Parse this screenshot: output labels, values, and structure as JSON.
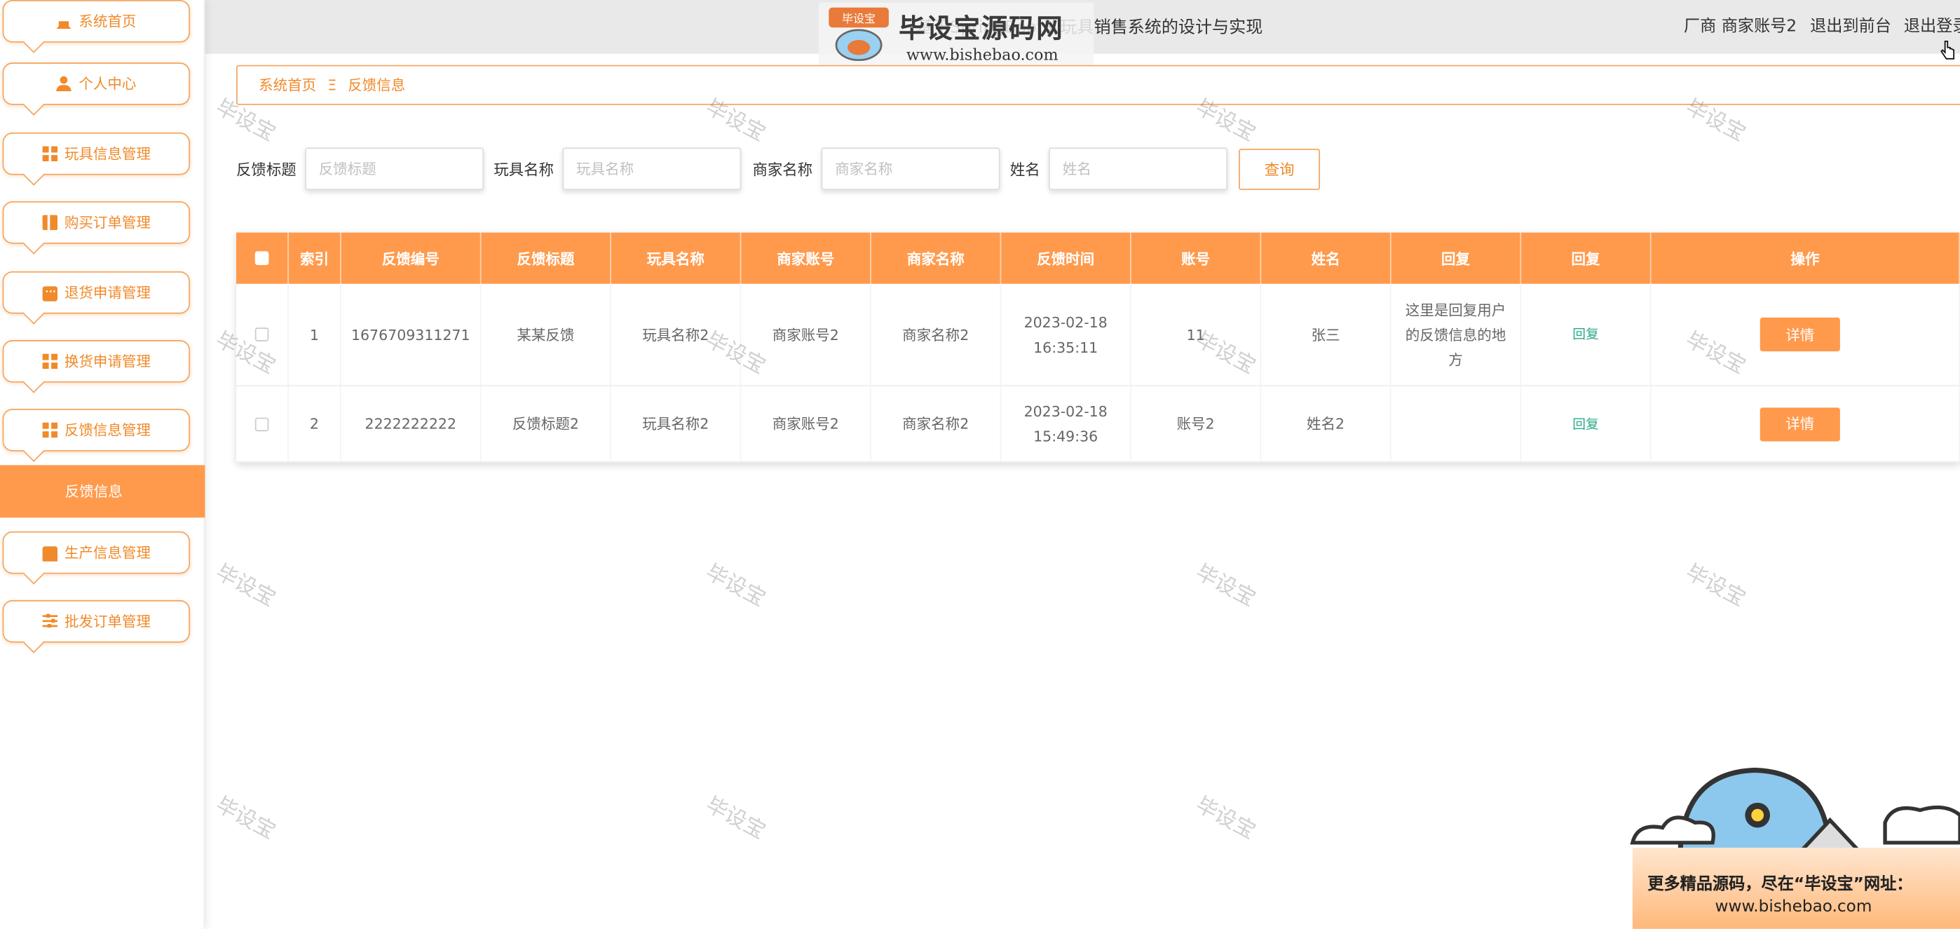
{
  "header": {
    "title": "基于SpringBoot的玩具销售系统的设计与实现",
    "user": "厂商 商家账号2",
    "to_front": "退出到前台",
    "logout": "退出登录"
  },
  "logo": {
    "badge": "毕设宝",
    "name": "毕设宝源码网",
    "url": "www.bishebao.com"
  },
  "sidebar": {
    "items": [
      {
        "label": "系统首页",
        "icon": "home-icon"
      },
      {
        "label": "个人中心",
        "icon": "user-icon"
      },
      {
        "label": "玩具信息管理",
        "icon": "grid-icon"
      },
      {
        "label": "购买订单管理",
        "icon": "box-icon"
      },
      {
        "label": "退货申请管理",
        "icon": "chat-icon"
      },
      {
        "label": "换货申请管理",
        "icon": "grid-icon"
      },
      {
        "label": "反馈信息管理",
        "icon": "grid-icon"
      },
      {
        "label": "生产信息管理",
        "icon": "print-icon"
      },
      {
        "label": "批发订单管理",
        "icon": "sliders-icon"
      }
    ],
    "active_sub": "反馈信息"
  },
  "breadcrumb": {
    "home": "系统首页",
    "separator": "Ξ",
    "current": "反馈信息"
  },
  "search": {
    "fields": [
      {
        "label": "反馈标题",
        "placeholder": "反馈标题"
      },
      {
        "label": "玩具名称",
        "placeholder": "玩具名称"
      },
      {
        "label": "商家名称",
        "placeholder": "商家名称"
      },
      {
        "label": "姓名",
        "placeholder": "姓名"
      }
    ],
    "button": "查询"
  },
  "table": {
    "headers": [
      "索引",
      "反馈编号",
      "反馈标题",
      "玩具名称",
      "商家账号",
      "商家名称",
      "反馈时间",
      "账号",
      "姓名",
      "回复",
      "回复",
      "操作"
    ],
    "rows": [
      {
        "index": "1",
        "code": "1676709311271",
        "title": "某某反馈",
        "toy": "玩具名称2",
        "merchant_account": "商家账号2",
        "merchant_name": "商家名称2",
        "time": "2023-02-18 16:35:11",
        "account": "11",
        "name": "张三",
        "reply_text": "这里是回复用户的反馈信息的地方",
        "reply_link": "回复",
        "action": "详情"
      },
      {
        "index": "2",
        "code": "2222222222",
        "title": "反馈标题2",
        "toy": "玩具名称2",
        "merchant_account": "商家账号2",
        "merchant_name": "商家名称2",
        "time": "2023-02-18 15:49:36",
        "account": "账号2",
        "name": "姓名2",
        "reply_text": "",
        "reply_link": "回复",
        "action": "详情"
      }
    ]
  },
  "watermark": "毕设宝",
  "ad": {
    "line1": "更多精品源码，尽在“毕设宝”网址：",
    "line2": "www.bishebao.com"
  },
  "colors": {
    "accent": "#ff9a4c",
    "accent_text": "#f08a2a",
    "link_green": "#2aa88a"
  }
}
